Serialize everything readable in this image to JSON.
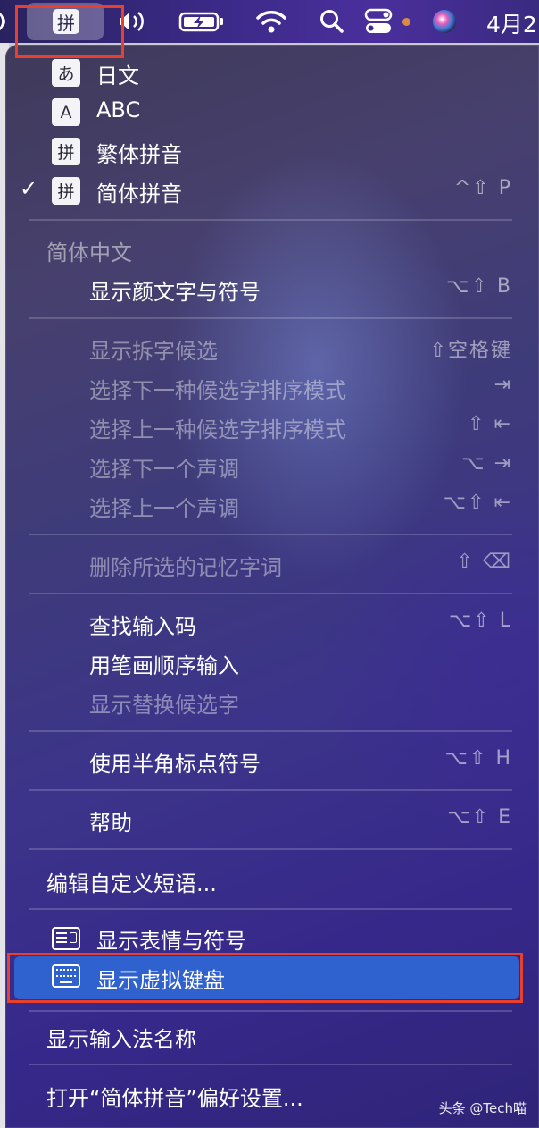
{
  "menubar": {
    "clock": "4月2",
    "ime_glyph": "拼"
  },
  "menu": {
    "input_sources": [
      {
        "badge": "あ",
        "label": "日文"
      },
      {
        "badge": "A",
        "label": "ABC"
      },
      {
        "badge": "拼",
        "label": "繁体拼音"
      },
      {
        "badge": "拼",
        "label": "简体拼音",
        "checked": true,
        "check_mark": "✓",
        "shortcut": "^⇧ P"
      }
    ],
    "section_header": "简体中文",
    "emoji_kaomoji": {
      "label": "显示颜文字与符号",
      "shortcut": "⌥⇧ B"
    },
    "candidate_items": [
      {
        "label": "显示拆字候选",
        "shortcut": "⇧空格键"
      },
      {
        "label": "选择下一种候选字排序模式",
        "shortcut": "⇥"
      },
      {
        "label": "选择上一种候选字排序模式",
        "shortcut": "⇧ ⇤"
      },
      {
        "label": "选择下一个声调",
        "shortcut": "⌥ ⇥"
      },
      {
        "label": "选择上一个声调",
        "shortcut": "⌥⇧ ⇤"
      }
    ],
    "delete_memory": {
      "label": "删除所选的记忆字词",
      "shortcut": "⇧ ⌫"
    },
    "lookup_items": [
      {
        "label": "查找输入码",
        "shortcut": "⌥⇧ L"
      },
      {
        "label": "用笔画顺序输入",
        "shortcut": ""
      },
      {
        "label": "显示替换候选字",
        "shortcut": ""
      }
    ],
    "halfwidth": {
      "label": "使用半角标点符号",
      "shortcut": "⌥⇧ H"
    },
    "help": {
      "label": "帮助",
      "shortcut": "⌥⇧ E"
    },
    "edit_phrases": "编辑自定义短语...",
    "show_emoji": "显示表情与符号",
    "show_keyboard": "显示虚拟键盘",
    "show_name": "显示输入法名称",
    "open_prefs": "打开“简体拼音”偏好设置..."
  },
  "watermark": "头条 @Tech喵",
  "colors": {
    "highlight_border": "#e8402c",
    "selected_row": "#2f62cf"
  }
}
